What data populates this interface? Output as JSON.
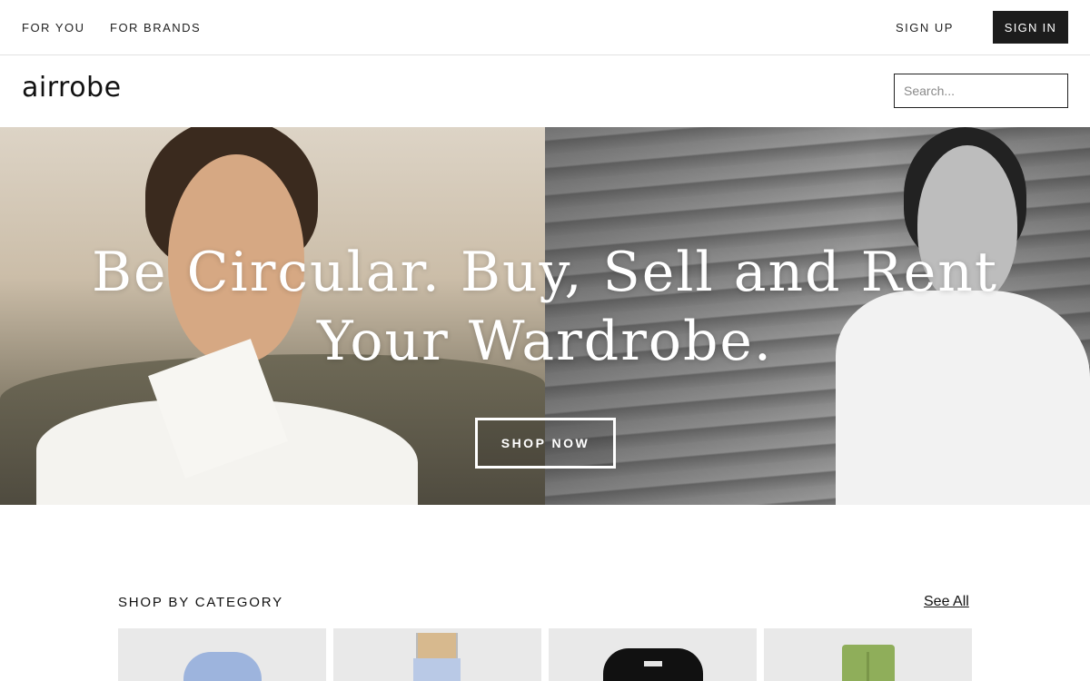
{
  "topbar": {
    "for_you": "FOR YOU",
    "for_brands": "FOR BRANDS",
    "sign_up": "SIGN UP",
    "sign_in": "SIGN IN"
  },
  "header": {
    "logo": "airrobe",
    "search_placeholder": "Search..."
  },
  "hero": {
    "title_line1": "Be Circular. Buy, Sell and Rent",
    "title_line2": "Your Wardrobe.",
    "cta": "SHOP NOW"
  },
  "categories": {
    "title": "SHOP BY CATEGORY",
    "see_all": "See All",
    "items": [
      {
        "icon": "shirt-icon",
        "color": "#9db4dd"
      },
      {
        "icon": "dress-icon",
        "color": "#b9c9e6"
      },
      {
        "icon": "jacket-icon",
        "color": "#111111"
      },
      {
        "icon": "pants-icon",
        "color": "#8fae5a"
      }
    ]
  },
  "colors": {
    "sign_in_bg": "#1c1c1c",
    "category_card_bg": "#e9e9e9"
  }
}
